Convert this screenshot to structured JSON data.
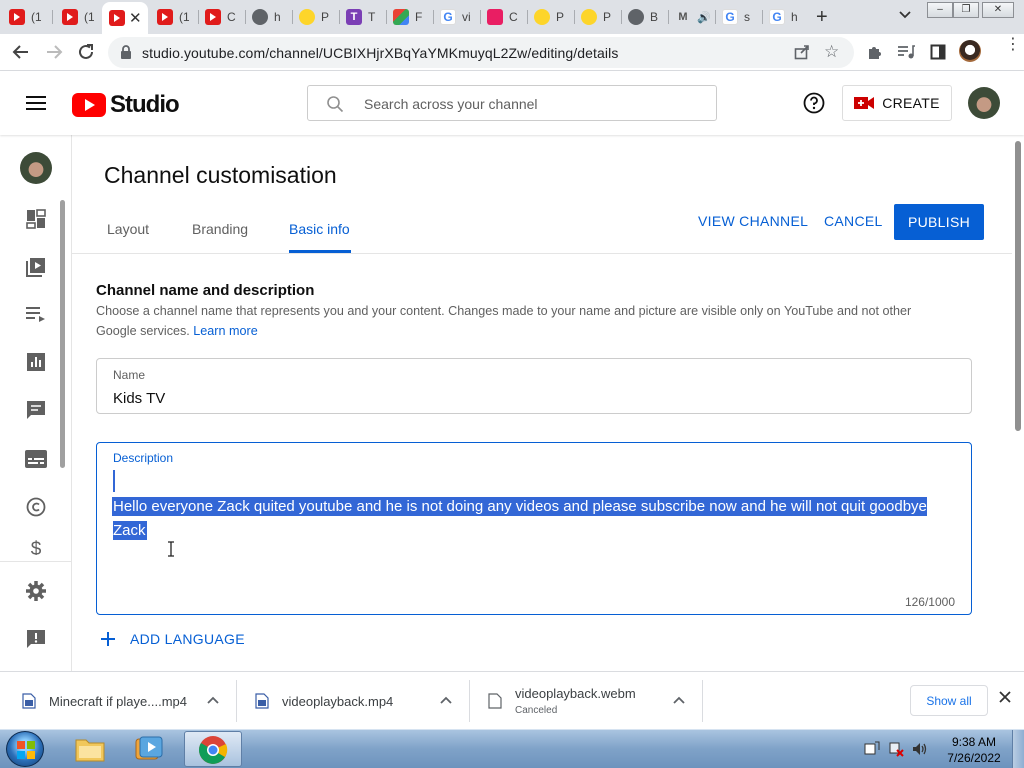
{
  "browser": {
    "tabs": [
      {
        "title": "(1",
        "favicon": "youtube-icon"
      },
      {
        "title": "(1",
        "favicon": "youtube-icon"
      },
      {
        "title": "",
        "favicon": "youtube-icon",
        "active": true
      },
      {
        "title": "(1",
        "favicon": "youtube-icon"
      },
      {
        "title": "C",
        "favicon": "youtube-icon"
      },
      {
        "title": "h",
        "favicon": "globe-icon"
      },
      {
        "title": "P",
        "favicon": "smiley-icon"
      },
      {
        "title": "T",
        "favicon": "t-icon"
      },
      {
        "title": "F",
        "favicon": "colorful-icon"
      },
      {
        "title": "vi",
        "favicon": "google-icon"
      },
      {
        "title": "C",
        "favicon": "heart-icon"
      },
      {
        "title": "P",
        "favicon": "smiley-icon"
      },
      {
        "title": "P",
        "favicon": "smiley-icon"
      },
      {
        "title": "B",
        "favicon": "globe-icon"
      },
      {
        "title": "M",
        "favicon": "m-icon"
      },
      {
        "title": "s",
        "favicon": "google-icon"
      },
      {
        "title": "h",
        "favicon": "google-icon"
      }
    ],
    "url": "studio.youtube.com/channel/UCBIXHjrXBqYaYMKmuyqL2Zw/editing/details"
  },
  "header": {
    "logo_text": "Studio",
    "search_placeholder": "Search across your channel",
    "create_label": "CREATE"
  },
  "main": {
    "title": "Channel customisation",
    "tabs": [
      {
        "label": "Layout"
      },
      {
        "label": "Branding"
      },
      {
        "label": "Basic info",
        "active": true
      }
    ],
    "view_channel_label": "VIEW CHANNEL",
    "cancel_label": "CANCEL",
    "publish_label": "PUBLISH",
    "section_title": "Channel name and description",
    "section_desc": "Choose a channel name that represents you and your content. Changes made to your name and picture are visible only on YouTube and not other Google services.",
    "learn_more": "Learn more",
    "name_label": "Name",
    "name_value": "Kids TV",
    "description_label": "Description",
    "description_value": "Hello everyone Zack quited youtube and he is not doing any videos and please subscribe now and he will not quit goodbye Zack",
    "description_counter": "126/1000",
    "add_language": "ADD LANGUAGE"
  },
  "downloads": {
    "items": [
      {
        "name": "Minecraft if playe....mp4",
        "status": ""
      },
      {
        "name": "videoplayback.mp4",
        "status": ""
      },
      {
        "name": "videoplayback.webm",
        "status": "Canceled"
      }
    ],
    "show_all": "Show all"
  },
  "taskbar": {
    "time": "9:38 AM",
    "date": "7/26/2022"
  },
  "colors": {
    "accent": "#065fd4",
    "youtube_red": "#ff0000",
    "selection": "#3367d6"
  }
}
